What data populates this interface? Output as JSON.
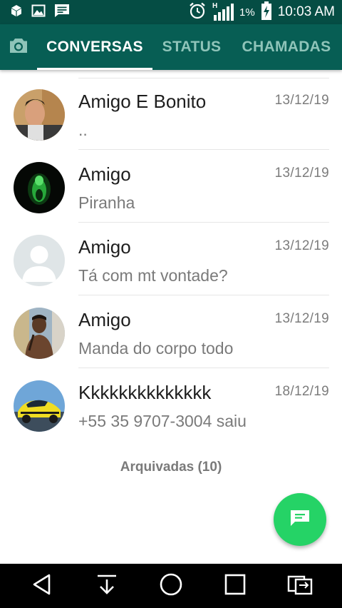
{
  "status_bar": {
    "network": "H",
    "battery_percent": "1%",
    "time": "10:03 AM"
  },
  "tabs": [
    {
      "label": "CONVERSAS",
      "active": true
    },
    {
      "label": "STATUS",
      "active": false
    },
    {
      "label": "CHAMADAS",
      "active": false
    }
  ],
  "chats": [
    {
      "name": "Amigo E Bonito",
      "date": "13/12/19",
      "preview": ".."
    },
    {
      "name": "Amigo",
      "date": "13/12/19",
      "preview": "Piranha"
    },
    {
      "name": "Amigo",
      "date": "13/12/19",
      "preview": "Tá com mt vontade?"
    },
    {
      "name": "Amigo",
      "date": "13/12/19",
      "preview": "Manda do corpo todo"
    },
    {
      "name": "Kkkkkkkkkkkkkk",
      "date": "18/12/19",
      "preview": "+55 35 9707-3004 saiu"
    }
  ],
  "archived_label": "Arquivadas (10)",
  "colors": {
    "app_bar": "#075e54",
    "status_bar": "#054d44",
    "fab": "#25d366"
  }
}
